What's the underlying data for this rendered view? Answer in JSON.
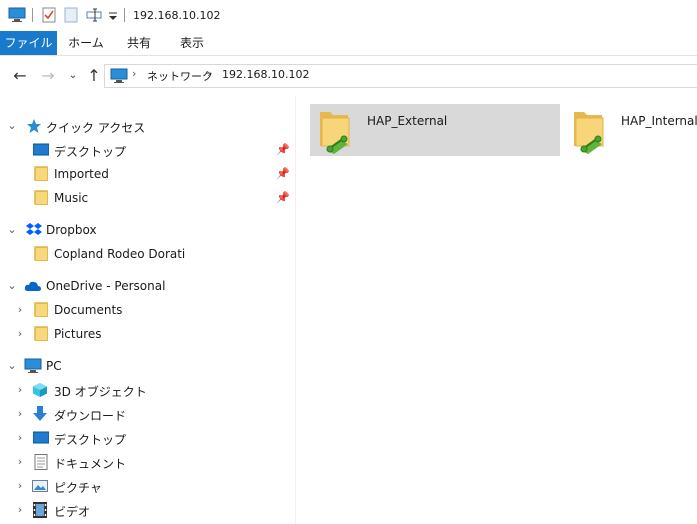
{
  "titlebar": {
    "title": "192.168.10.102",
    "icons": [
      "computer-icon",
      "properties-check-icon",
      "new-folder-icon",
      "rename-icon",
      "customize-dropdown-icon"
    ]
  },
  "ribbon": {
    "tabs": [
      {
        "label": "ファイル",
        "active": true
      },
      {
        "label": "ホーム"
      },
      {
        "label": "共有"
      },
      {
        "label": "表示"
      }
    ]
  },
  "address": {
    "back_icon": "back-arrow-icon",
    "forward_icon": "forward-arrow-icon",
    "recent_icon": "recent-dropdown-icon",
    "up_icon": "up-arrow-icon",
    "crumbs": [
      "ネットワーク",
      "192.168.10.102"
    ]
  },
  "sidebar": {
    "quick_access": {
      "label": "クイック アクセス",
      "items": [
        {
          "label": "デスクトップ",
          "icon": "desktop-icon",
          "pinned": true
        },
        {
          "label": "Imported",
          "icon": "folder-icon",
          "pinned": true
        },
        {
          "label": "Music",
          "icon": "folder-icon",
          "pinned": true
        }
      ]
    },
    "dropbox": {
      "label": "Dropbox",
      "items": [
        {
          "label": "Copland Rodeo Dorati",
          "icon": "folder-icon"
        }
      ]
    },
    "onedrive": {
      "label": "OneDrive - Personal",
      "items": [
        {
          "label": "Documents",
          "icon": "folder-icon"
        },
        {
          "label": "Pictures",
          "icon": "folder-icon"
        }
      ]
    },
    "pc": {
      "label": "PC",
      "items": [
        {
          "label": "3D オブジェクト",
          "icon": "3d-objects-icon"
        },
        {
          "label": "ダウンロード",
          "icon": "download-icon"
        },
        {
          "label": "デスクトップ",
          "icon": "desktop-icon"
        },
        {
          "label": "ドキュメント",
          "icon": "documents-icon"
        },
        {
          "label": "ピクチャ",
          "icon": "pictures-icon"
        },
        {
          "label": "ビデオ",
          "icon": "videos-icon"
        }
      ]
    }
  },
  "content": {
    "items": [
      {
        "name": "HAP_External",
        "icon": "network-share-icon",
        "selected": true
      },
      {
        "name": "HAP_Internal",
        "icon": "network-share-icon",
        "selected": false
      }
    ]
  },
  "colors": {
    "accent": "#1979ca",
    "selection": "#d9d9d9",
    "folder": "#f7d87c"
  }
}
